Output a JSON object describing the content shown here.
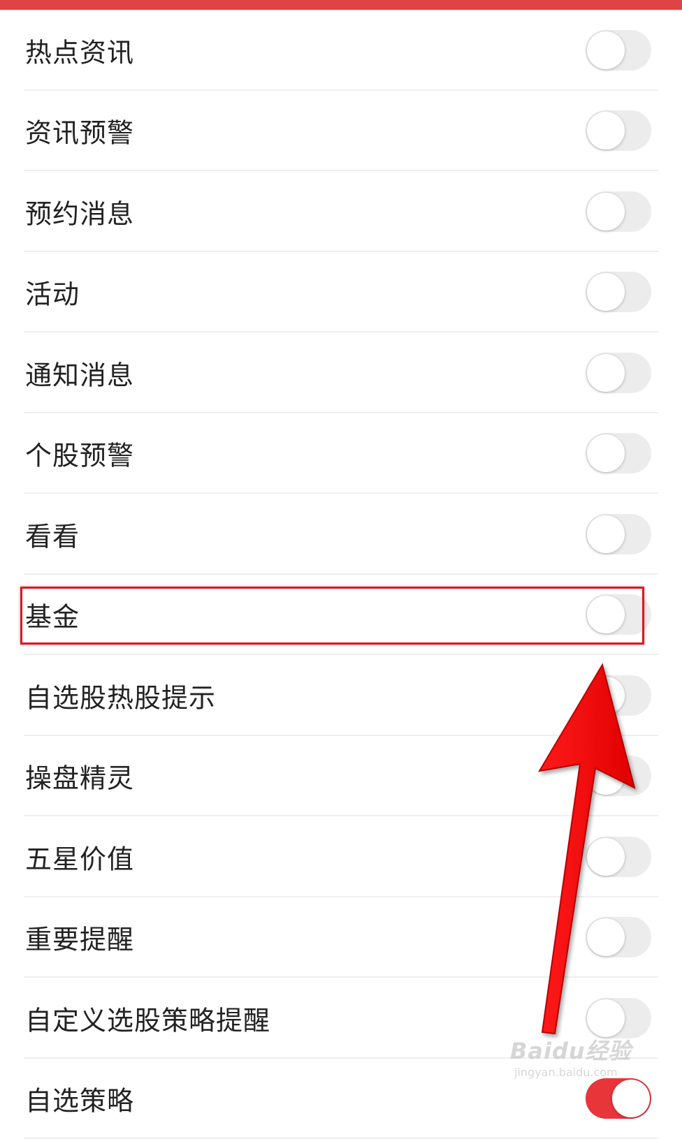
{
  "colors": {
    "accent": "#dd4446",
    "toggle_on": "#e8353a",
    "toggle_off": "#ececec",
    "highlight": "#e5161c"
  },
  "settings": {
    "items": [
      {
        "label": "热点资讯",
        "enabled": false
      },
      {
        "label": "资讯预警",
        "enabled": false
      },
      {
        "label": "预约消息",
        "enabled": false
      },
      {
        "label": "活动",
        "enabled": false
      },
      {
        "label": "通知消息",
        "enabled": false
      },
      {
        "label": "个股预警",
        "enabled": false
      },
      {
        "label": "看看",
        "enabled": false
      },
      {
        "label": "基金",
        "enabled": false,
        "highlighted": true
      },
      {
        "label": "自选股热股提示",
        "enabled": false
      },
      {
        "label": "操盘精灵",
        "enabled": false
      },
      {
        "label": "五星价值",
        "enabled": false
      },
      {
        "label": "重要提醒",
        "enabled": false
      },
      {
        "label": "自定义选股策略提醒",
        "enabled": false
      },
      {
        "label": "自选策略",
        "enabled": true
      }
    ]
  },
  "watermark": {
    "main": "Baidu经验",
    "sub": "jingyan.baidu.com"
  },
  "annotation": {
    "arrow_icon": "red-arrow-icon"
  }
}
